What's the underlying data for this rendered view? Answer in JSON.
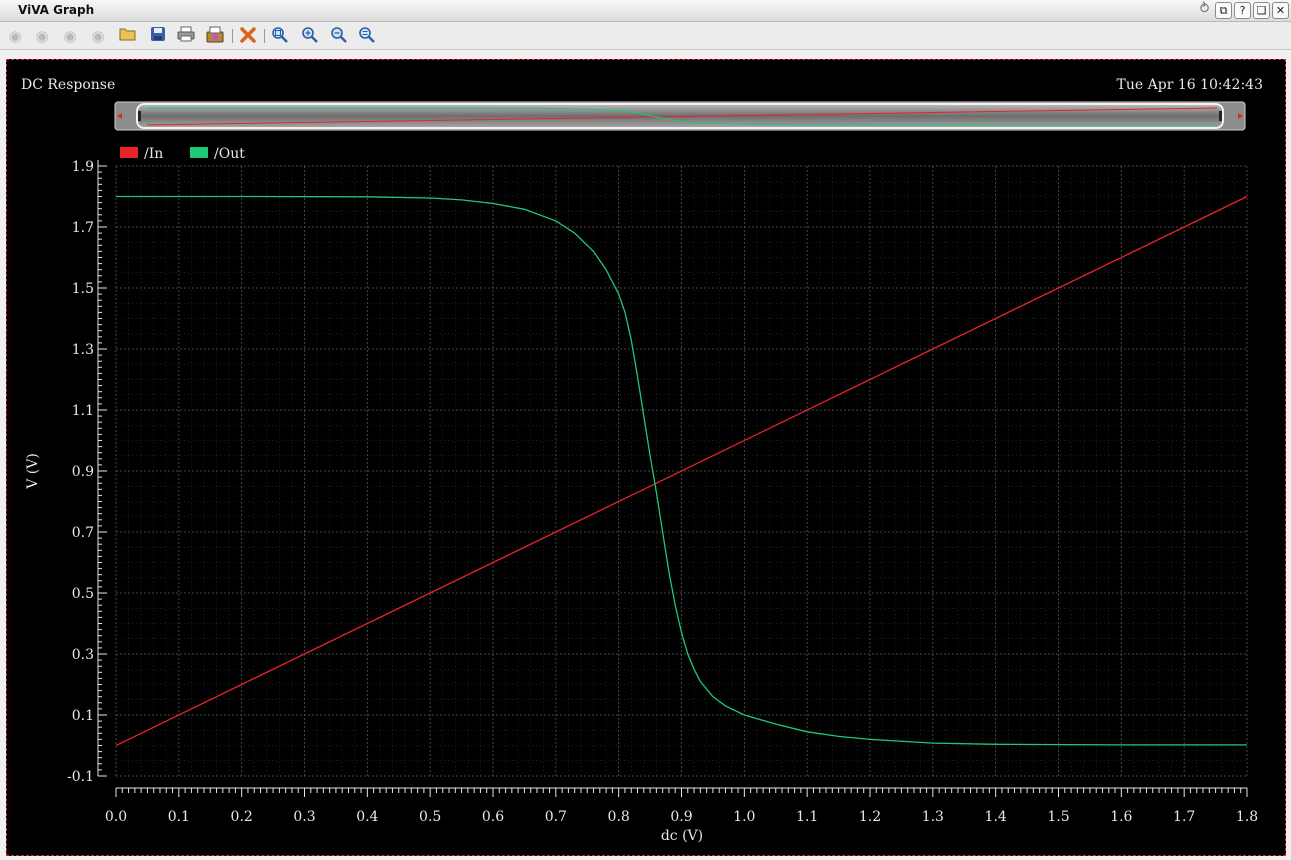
{
  "window": {
    "title": "ViVA Graph",
    "controls": [
      "⥁",
      "⧉",
      "?",
      "❏",
      "✕"
    ]
  },
  "toolbar": {
    "icons": [
      "nav-back-icon",
      "nav-forward-icon",
      "nav-up-icon",
      "nav-down-icon",
      "open-folder-icon",
      "save-icon",
      "print-icon",
      "print-preview-icon",
      "delete-icon",
      "zoom-fit-icon",
      "zoom-in-icon",
      "zoom-out-icon",
      "zoom-box-icon"
    ]
  },
  "graph": {
    "title": "DC Response",
    "date": "Tue Apr 16 10:42:43",
    "colors": {
      "background": "#000000",
      "in": "#e8232a",
      "out": "#1fc874",
      "grid": "#3a3a3a",
      "text": "#e8e8e8"
    }
  },
  "chart_data": {
    "type": "line",
    "xlabel": "dc (V)",
    "ylabel": "V (V)",
    "xlim": [
      0.0,
      1.8
    ],
    "ylim": [
      -0.1,
      1.9
    ],
    "xticks": [
      "0.0",
      "0.1",
      "0.2",
      "0.3",
      "0.4",
      "0.5",
      "0.6",
      "0.7",
      "0.8",
      "0.9",
      "1.0",
      "1.1",
      "1.2",
      "1.3",
      "1.4",
      "1.5",
      "1.6",
      "1.7",
      "1.8"
    ],
    "yticks": [
      "-0.1",
      "0.1",
      "0.3",
      "0.5",
      "0.7",
      "0.9",
      "1.1",
      "1.3",
      "1.5",
      "1.7",
      "1.9"
    ],
    "legend_position": "top-left",
    "grid": true,
    "series": [
      {
        "name": "/In",
        "color": "#e8232a",
        "x": [
          0.0,
          1.8
        ],
        "y": [
          0.0,
          1.8
        ]
      },
      {
        "name": "/Out",
        "color": "#1fc874",
        "x": [
          0.0,
          0.2,
          0.4,
          0.5,
          0.55,
          0.6,
          0.65,
          0.7,
          0.73,
          0.76,
          0.78,
          0.8,
          0.81,
          0.82,
          0.83,
          0.84,
          0.85,
          0.86,
          0.87,
          0.88,
          0.89,
          0.9,
          0.91,
          0.92,
          0.93,
          0.95,
          0.97,
          1.0,
          1.05,
          1.1,
          1.15,
          1.2,
          1.3,
          1.4,
          1.6,
          1.8
        ],
        "y": [
          1.8,
          1.8,
          1.799,
          1.795,
          1.789,
          1.777,
          1.758,
          1.72,
          1.68,
          1.62,
          1.56,
          1.48,
          1.42,
          1.33,
          1.21,
          1.08,
          0.95,
          0.83,
          0.7,
          0.57,
          0.46,
          0.37,
          0.3,
          0.25,
          0.21,
          0.16,
          0.13,
          0.1,
          0.07,
          0.045,
          0.03,
          0.02,
          0.008,
          0.004,
          0.002,
          0.002
        ]
      }
    ]
  }
}
